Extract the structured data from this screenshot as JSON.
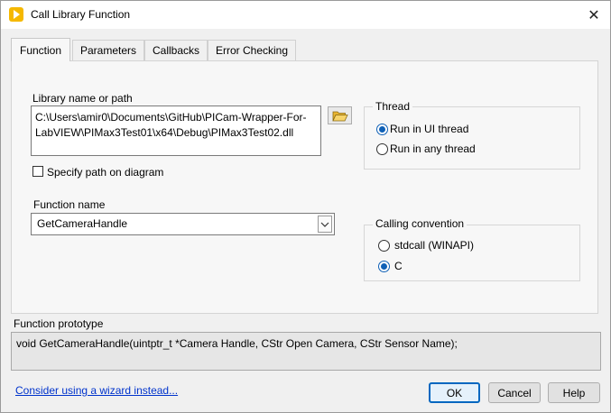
{
  "window": {
    "title": "Call Library Function"
  },
  "tabs": [
    "Function",
    "Parameters",
    "Callbacks",
    "Error Checking"
  ],
  "function_tab": {
    "library_label": "Library name or path",
    "library_path_line1": "C:\\Users\\amir0\\Documents\\GitHub\\PICam-Wrapper-For-",
    "library_path_line2": "LabVIEW\\PIMax3Test01\\x64\\Debug\\PIMax3Test02.dll",
    "specify_path_label": "Specify path on diagram",
    "specify_path_checked": false,
    "function_name_label": "Function name",
    "function_name_value": "GetCameraHandle",
    "thread": {
      "title": "Thread",
      "options": [
        "Run in UI thread",
        "Run in any thread"
      ],
      "selected": "Run in UI thread"
    },
    "calling_convention": {
      "title": "Calling convention",
      "options": [
        "stdcall (WINAPI)",
        "C"
      ],
      "selected": "C"
    }
  },
  "prototype": {
    "label": "Function prototype",
    "text": "void  GetCameraHandle(uintptr_t *Camera Handle, CStr Open Camera, CStr Sensor Name);"
  },
  "footer": {
    "wizard_link": "Consider using a wizard instead...",
    "ok_label": "OK",
    "cancel_label": "Cancel",
    "help_label": "Help"
  },
  "icons": {
    "app": "labview-play-icon",
    "close": "close-icon",
    "folder": "folder-open-icon",
    "dropdown": "chevron-down-icon"
  },
  "colors": {
    "accent": "#0067c0",
    "link": "#0033cc",
    "app_icon": "#f5b800"
  }
}
